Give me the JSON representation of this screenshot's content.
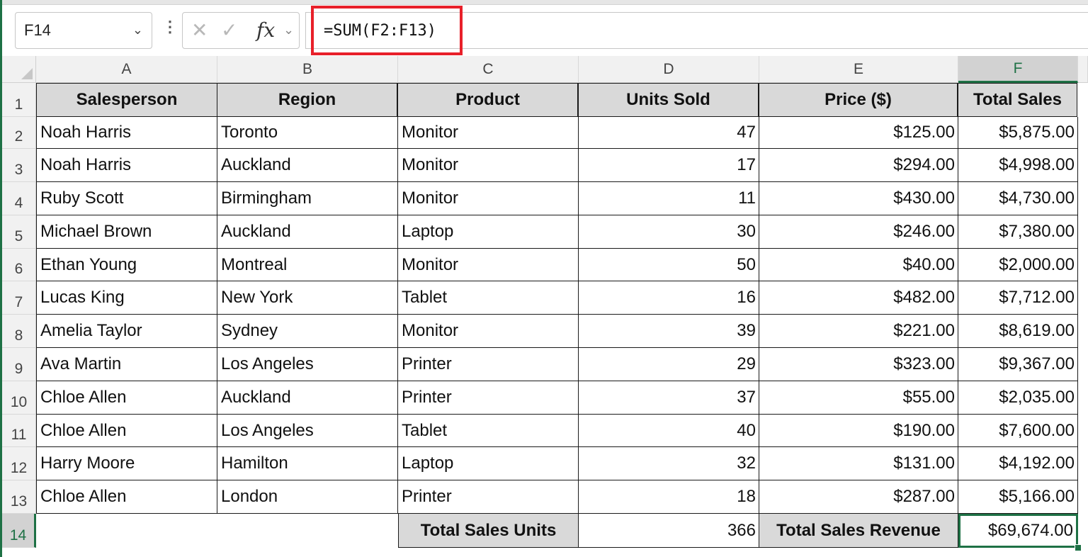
{
  "formula_bar": {
    "name_box": "F14",
    "formula": "=SUM(F2:F13)"
  },
  "columns": [
    "A",
    "B",
    "C",
    "D",
    "E",
    "F"
  ],
  "rows": [
    "1",
    "2",
    "3",
    "4",
    "5",
    "6",
    "7",
    "8",
    "9",
    "10",
    "11",
    "12",
    "13",
    "14"
  ],
  "headers": [
    "Salesperson",
    "Region",
    "Product",
    "Units Sold",
    "Price ($)",
    "Total Sales"
  ],
  "data": [
    [
      "Noah Harris",
      "Toronto",
      "Monitor",
      "47",
      "$125.00",
      "$5,875.00"
    ],
    [
      "Noah Harris",
      "Auckland",
      "Monitor",
      "17",
      "$294.00",
      "$4,998.00"
    ],
    [
      "Ruby Scott",
      "Birmingham",
      "Monitor",
      "11",
      "$430.00",
      "$4,730.00"
    ],
    [
      "Michael Brown",
      "Auckland",
      "Laptop",
      "30",
      "$246.00",
      "$7,380.00"
    ],
    [
      "Ethan Young",
      "Montreal",
      "Monitor",
      "50",
      "$40.00",
      "$2,000.00"
    ],
    [
      "Lucas King",
      "New York",
      "Tablet",
      "16",
      "$482.00",
      "$7,712.00"
    ],
    [
      "Amelia Taylor",
      "Sydney",
      "Monitor",
      "39",
      "$221.00",
      "$8,619.00"
    ],
    [
      "Ava Martin",
      "Los Angeles",
      "Printer",
      "29",
      "$323.00",
      "$9,367.00"
    ],
    [
      "Chloe Allen",
      "Auckland",
      "Printer",
      "37",
      "$55.00",
      "$2,035.00"
    ],
    [
      "Chloe Allen",
      "Los Angeles",
      "Tablet",
      "40",
      "$190.00",
      "$7,600.00"
    ],
    [
      "Harry Moore",
      "Hamilton",
      "Laptop",
      "32",
      "$131.00",
      "$4,192.00"
    ],
    [
      "Chloe Allen",
      "London",
      "Printer",
      "18",
      "$287.00",
      "$5,166.00"
    ]
  ],
  "totals": {
    "units_label": "Total Sales Units",
    "units_value": "366",
    "revenue_label": "Total Sales Revenue",
    "revenue_value": "$69,674.00"
  },
  "active_cell": "F14"
}
